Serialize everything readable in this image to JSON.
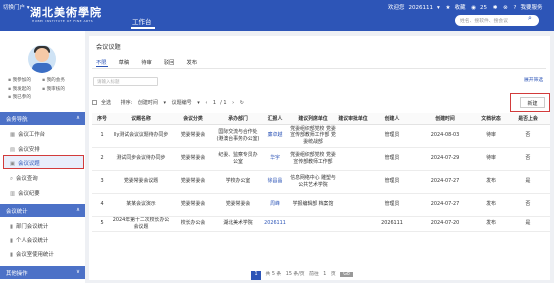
{
  "topbar": {
    "portal": "切换门户",
    "brand": "湖北美術學院",
    "brand_sub": "HUBEI INSTITUTE OF FINE ARTS",
    "tab": "工作台",
    "welcome": "欢迎您",
    "user": "2026111",
    "favorites": "收藏",
    "count": "25",
    "help": "我要服务",
    "search_placeholder": "姓名、搜软件、搜会议"
  },
  "left": {
    "quick_links": [
      "我参加的",
      "我的会务",
      "我发起的",
      "我审核的",
      "我已参的"
    ],
    "sec_meeting": "会务导航",
    "nav_items": [
      "会议工作台",
      "会议安排",
      "会议议题",
      "会议查询",
      "会议纪要"
    ],
    "sec_stats": "会议统计",
    "stat_items": [
      "部门会议统计",
      "个人会议统计",
      "会议室使用统计"
    ],
    "sec_other": "其他操作"
  },
  "main": {
    "title": "会议议题",
    "tabs": [
      "不限",
      "草稿",
      "待审",
      "驳回",
      "发布"
    ],
    "keyword_placeholder": "请输入标题",
    "advanced": "展开筛选",
    "select_all": "全选",
    "sort_label": "排序:",
    "sort_by": "创建时间",
    "sort_by2": "议题编号",
    "page_cur": "1",
    "page_total": "/ 1",
    "new_button": "新建",
    "columns": [
      "序号",
      "议题名称",
      "会议分类",
      "承办部门",
      "汇报人",
      "建议列席单位",
      "建议审批单位",
      "创建人",
      "创建时间",
      "文档状态",
      "是否上会"
    ],
    "rows": [
      [
        "1",
        "lly测试会议议题待办同步",
        "党委常委会",
        "国际交流与合作处(港澳台事务办公室)",
        "廉卓越",
        "党委组织部党校 党委宣传部教师工作部 党委统战部",
        "",
        "管理员",
        "2024-08-03",
        "待审",
        "否"
      ],
      [
        "2",
        "测试同步会议待办同步",
        "党委常委会",
        "纪委、监察专员办公室",
        "华宇",
        "党委组织部党校 党委宣传部教师工作部",
        "",
        "管理员",
        "2024-07-29",
        "待审",
        "否"
      ],
      [
        "3",
        "党委常委会议题",
        "党委常委会",
        "学校办公室",
        "徐昌晶",
        "信息网络中心 雕塑与公共艺术学院",
        "",
        "管理员",
        "2024-07-27",
        "发布",
        "是"
      ],
      [
        "4",
        "某某会议演示",
        "党委常委会",
        "党委常委会",
        "周峰",
        "学报编辑部 档案馆",
        "",
        "管理员",
        "2024-07-27",
        "发布",
        "否"
      ],
      [
        "5",
        "2024年第十二次校长办公会议题",
        "校长办公会",
        "湖北美术学院",
        "2026111",
        "",
        "",
        "2026111",
        "2024-07-20",
        "发布",
        "是"
      ]
    ]
  },
  "pager": {
    "total": "共 5 条",
    "page": "1",
    "page_size": "15 条/页",
    "goto": "前往",
    "goto_page": "1",
    "goto_suffix": "页",
    "go": "Go"
  }
}
